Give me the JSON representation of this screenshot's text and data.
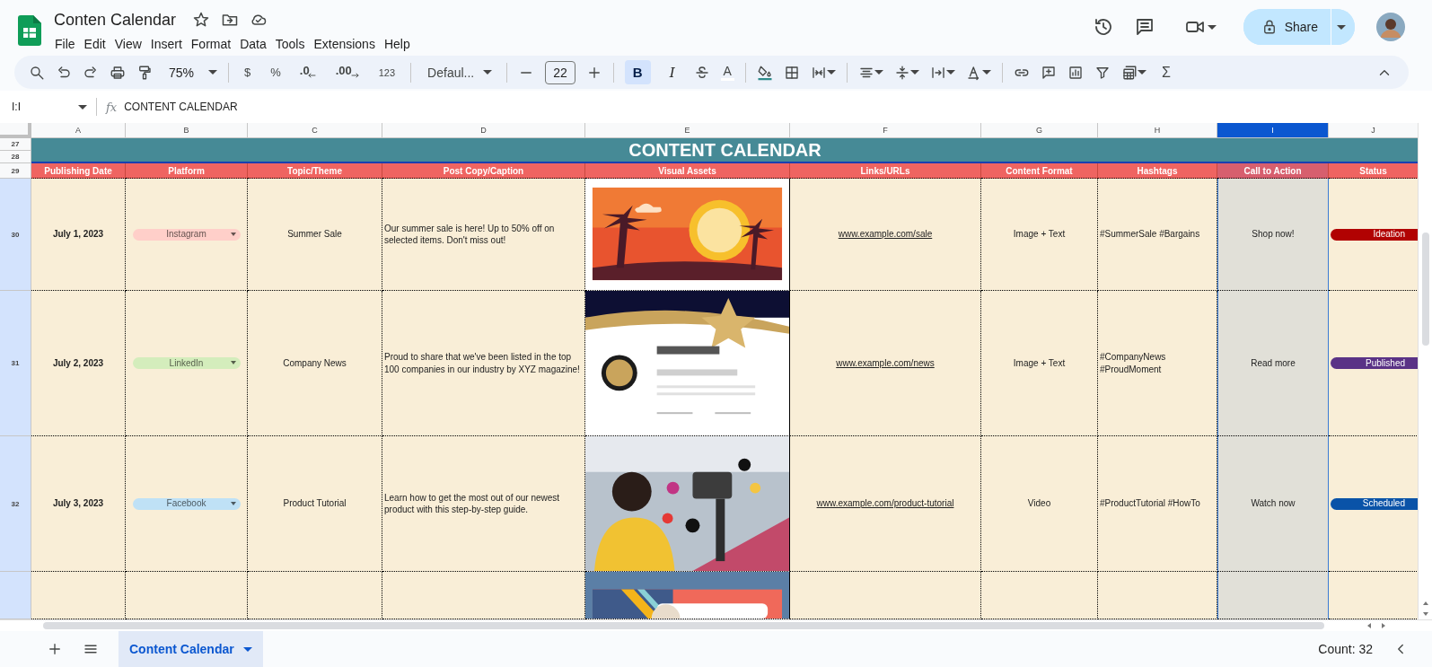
{
  "document": {
    "title": "Conten Calendar"
  },
  "menu": [
    "File",
    "Edit",
    "View",
    "Insert",
    "Format",
    "Data",
    "Tools",
    "Extensions",
    "Help"
  ],
  "share_button": "Share",
  "toolbar": {
    "zoom": "75%",
    "currency": "$",
    "percent": "%",
    "decrease_decimals": ".0",
    "increase_decimals": ".00",
    "number_format": "123",
    "font": "Defaul...",
    "font_size": "22",
    "text_color": "A",
    "sum": "Σ",
    "format_buttons": [
      {
        "kind": "bold",
        "label": "B",
        "active": true
      },
      {
        "kind": "italic",
        "label": "I",
        "active": false
      }
    ]
  },
  "formula_bar": {
    "name_box": "I:I",
    "label": "fx",
    "formula": "CONTENT CALENDAR"
  },
  "columns": [
    {
      "label": "A",
      "selected": false
    },
    {
      "label": "B",
      "selected": false
    },
    {
      "label": "C",
      "selected": false
    },
    {
      "label": "D",
      "selected": false
    },
    {
      "label": "E",
      "selected": false
    },
    {
      "label": "F",
      "selected": false
    },
    {
      "label": "G",
      "selected": false
    },
    {
      "label": "H",
      "selected": false
    },
    {
      "label": "I",
      "selected": true
    },
    {
      "label": "J",
      "selected": false
    }
  ],
  "title_band": {
    "row_numbers": [
      {
        "label": "27",
        "highlighted": false
      },
      {
        "label": "28",
        "highlighted": false
      }
    ],
    "text": "CONTENT CALENDAR"
  },
  "header_row": {
    "row_number": {
      "label": "29",
      "highlighted": false
    },
    "headers": [
      "Publishing Date",
      "Platform",
      "Topic/Theme",
      "Post Copy/Caption",
      "Visual Assets",
      "Links/URLs",
      "Content Format",
      "Hashtags",
      "Call to Action",
      "Status"
    ]
  },
  "rows": [
    {
      "row_number": {
        "label": "30",
        "highlighted": true
      },
      "date": "July 1, 2023",
      "platform": {
        "label": "Instagram",
        "color": "#ffcfc9"
      },
      "topic": "Summer Sale",
      "caption": "Our summer sale is here! Up to 50% off on selected items. Don't miss out!",
      "link": "www.example.com/sale",
      "format": "Image + Text",
      "hashtags": "#SummerSale #Bargains",
      "call_to_action": "Shop now!",
      "status": {
        "label": "Ideation",
        "color": "#b10202"
      }
    },
    {
      "row_number": {
        "label": "31",
        "highlighted": true
      },
      "date": "July 2, 2023",
      "platform": {
        "label": "LinkedIn",
        "color": "#d4edbc"
      },
      "topic": "Company News",
      "caption": "Proud to share that we've been listed in the top 100 companies in our industry by XYZ magazine!",
      "link": "www.example.com/news",
      "format": "Image + Text",
      "hashtags": "#CompanyNews #ProudMoment",
      "call_to_action": "Read more",
      "status": {
        "label": "Published",
        "color": "#5a3286"
      }
    },
    {
      "row_number": {
        "label": "32",
        "highlighted": true
      },
      "date": "July 3, 2023",
      "platform": {
        "label": "Facebook",
        "color": "#bfe1f6"
      },
      "topic": "Product Tutorial",
      "caption": "Learn how to get the most out of our newest product with this step-by-step guide.",
      "link": "www.example.com/product-tutorial",
      "format": "Video",
      "hashtags": "#ProductTutorial #HowTo",
      "call_to_action": "Watch now",
      "status": {
        "label": "Scheduled",
        "color": "#0a53a8"
      }
    }
  ],
  "partial_row": {
    "row_number": {
      "highlighted": true
    }
  },
  "sheet_tabs": [
    {
      "label": "Content Calendar",
      "selected": true
    }
  ],
  "status_bar": {
    "summary": "Count: 32"
  }
}
